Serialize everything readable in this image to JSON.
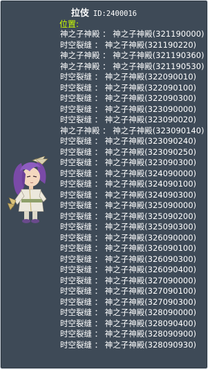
{
  "npc": {
    "name": "拉伎",
    "id_text": "ID:2400016"
  },
  "location_label": "位置:",
  "locations": [
    "神之子神殿 ： 神之子神殿(321190000)",
    "时空裂缝 ： 神之子神殿(321190220)",
    "神之子神殿 ： 神之子神殿(321190360)",
    "神之子神殿 ： 神之子神殿(321190530)",
    "时空裂缝 ： 神之子神殿(322090010)",
    "时空裂缝 ： 神之子神殿(322090100)",
    "时空裂缝 ： 神之子神殿(322090300)",
    "时空裂缝 ： 神之子神殿(323090000)",
    "时空裂缝 ： 神之子神殿(323090020)",
    "神之子神殿 ： 神之子神殿(323090140)",
    "时空裂缝 ： 神之子神殿(323090240)",
    "时空裂缝 ： 神之子神殿(323090250)",
    "时空裂缝 ： 神之子神殿(323090300)",
    "时空裂缝 ： 神之子神殿(324090000)",
    "时空裂缝 ： 神之子神殿(324090100)",
    "时空裂缝 ： 神之子神殿(324090300)",
    "时空裂缝 ： 神之子神殿(325090000)",
    "时空裂缝 ： 神之子神殿(325090200)",
    "时空裂缝 ： 神之子神殿(325090300)",
    "时空裂缝 ： 神之子神殿(326090000)",
    "时空裂缝 ： 神之子神殿(326090100)",
    "时空裂缝 ： 神之子神殿(326090300)",
    "时空裂缝 ： 神之子神殿(326090400)",
    "时空裂缝 ： 神之子神殿(327090000)",
    "时空裂缝 ： 神之子神殿(327090100)",
    "时空裂缝 ： 神之子神殿(327090300)",
    "时空裂缝 ： 神之子神殿(328090000)",
    "时空裂缝 ： 神之子神殿(328090400)",
    "时空裂缝 ： 神之子神殿(328090900)",
    "时空裂缝 ： 神之子神殿(328090930)"
  ],
  "colors": {
    "panel_background": "#3e4a57",
    "panel_border": "#c9d1da",
    "label_highlight": "#ccff00",
    "text": "#ffffff"
  },
  "icons": {
    "npc_portrait": "npc-portrait-icon"
  }
}
